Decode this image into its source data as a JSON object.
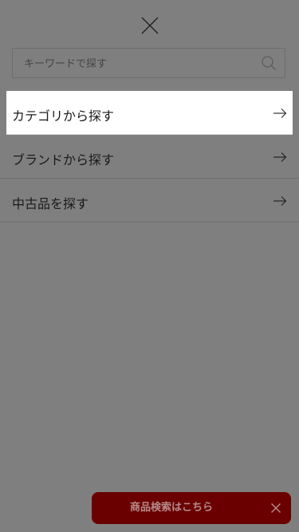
{
  "search": {
    "placeholder": "キーワードで探す"
  },
  "menu": {
    "items": [
      {
        "label": "カテゴリから探す"
      },
      {
        "label": "ブランドから探す"
      },
      {
        "label": "中古品を探す"
      }
    ]
  },
  "banner": {
    "text": "商品検索はこちら"
  },
  "colors": {
    "overlay": "#7f7f7f",
    "active_item_bg": "#ffffff",
    "banner_bg": "#6b0000",
    "banner_text": "#b58a8a"
  },
  "icons": {
    "top_close": "close-icon",
    "search": "search-icon",
    "menu_arrow": "arrow-right-icon",
    "banner_close": "close-icon"
  }
}
